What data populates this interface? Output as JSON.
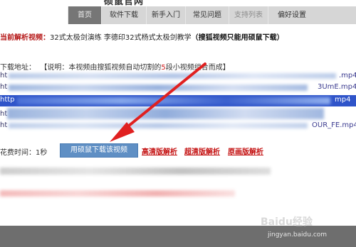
{
  "site": {
    "logo_text": "硕鼠官网"
  },
  "nav": {
    "items": [
      {
        "label": "首页"
      },
      {
        "label": "软件下载"
      },
      {
        "label": "新手入门"
      },
      {
        "label": "常见问题"
      },
      {
        "label": "支持列表"
      },
      {
        "label": "偏好设置"
      }
    ]
  },
  "current": {
    "label": "当前解析视频：",
    "title": "32式太极剑演练 李德印32式杨式太极剑教学",
    "note": "（搜狐视频只能用硕鼠下载）"
  },
  "download": {
    "label": "下载地址：",
    "note_before": "【说明：本视频由搜狐视频自动切割的",
    "note_count": "5",
    "note_after": "段小视频组合而成】"
  },
  "rows": [
    {
      "prefix": "ht",
      "suffix": ".mp4"
    },
    {
      "prefix": "ht",
      "suffix": "3UmE.mp4"
    },
    {
      "prefix": "http",
      "suffix": "mp4"
    },
    {
      "prefix": "ht",
      "suffix": ""
    },
    {
      "prefix": "ht",
      "suffix": "OUR_FE.mp4"
    }
  ],
  "cost": {
    "label": "花费时间：1秒"
  },
  "actions": {
    "download_button": "用硕鼠下载该视频",
    "hd": "高清版解析",
    "super_hd": "超清版解析",
    "original": "原画版解析"
  },
  "watermark": {
    "logo": "Baidu经验",
    "url": "jingyan.baidu.com"
  },
  "colors": {
    "accent_red": "#c41212",
    "highlight_blue": "#2f54c9",
    "button_blue": "#5f8fc4"
  }
}
